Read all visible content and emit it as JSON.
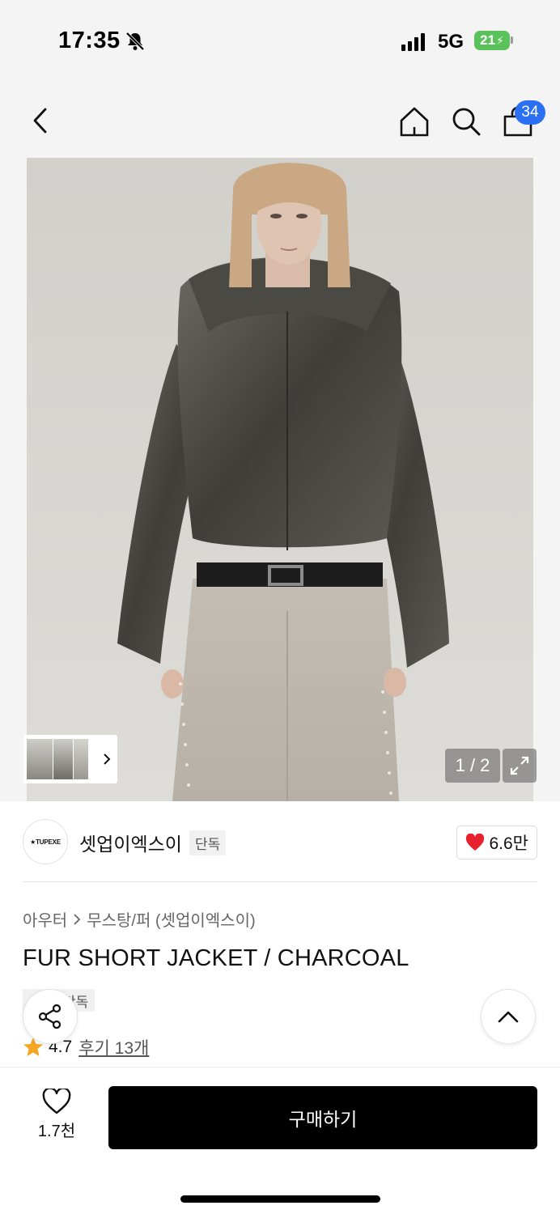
{
  "status_bar": {
    "time": "17:35",
    "network": "5G",
    "battery": "21"
  },
  "header": {
    "cart_count": "34"
  },
  "gallery": {
    "page_counter": "1 / 2"
  },
  "brand": {
    "logo_text": "★TUPEXE",
    "name": "셋업이엑스이",
    "tag": "단독",
    "likes": "6.6만"
  },
  "product": {
    "breadcrumb": [
      "아우터",
      "무스탕/퍼 (셋업이엑스이)"
    ],
    "title": "FUR SHORT JACKET / CHARCOAL",
    "tag": "단독",
    "rating": "4.7",
    "reviews": "후기 13개"
  },
  "bottom_bar": {
    "wish_count": "1.7천",
    "buy_label": "구매하기"
  },
  "colors": {
    "accent_blue": "#2b6ff2",
    "heart_red": "#e8212e",
    "star_orange": "#f5a623",
    "buy_bg": "#000000"
  }
}
